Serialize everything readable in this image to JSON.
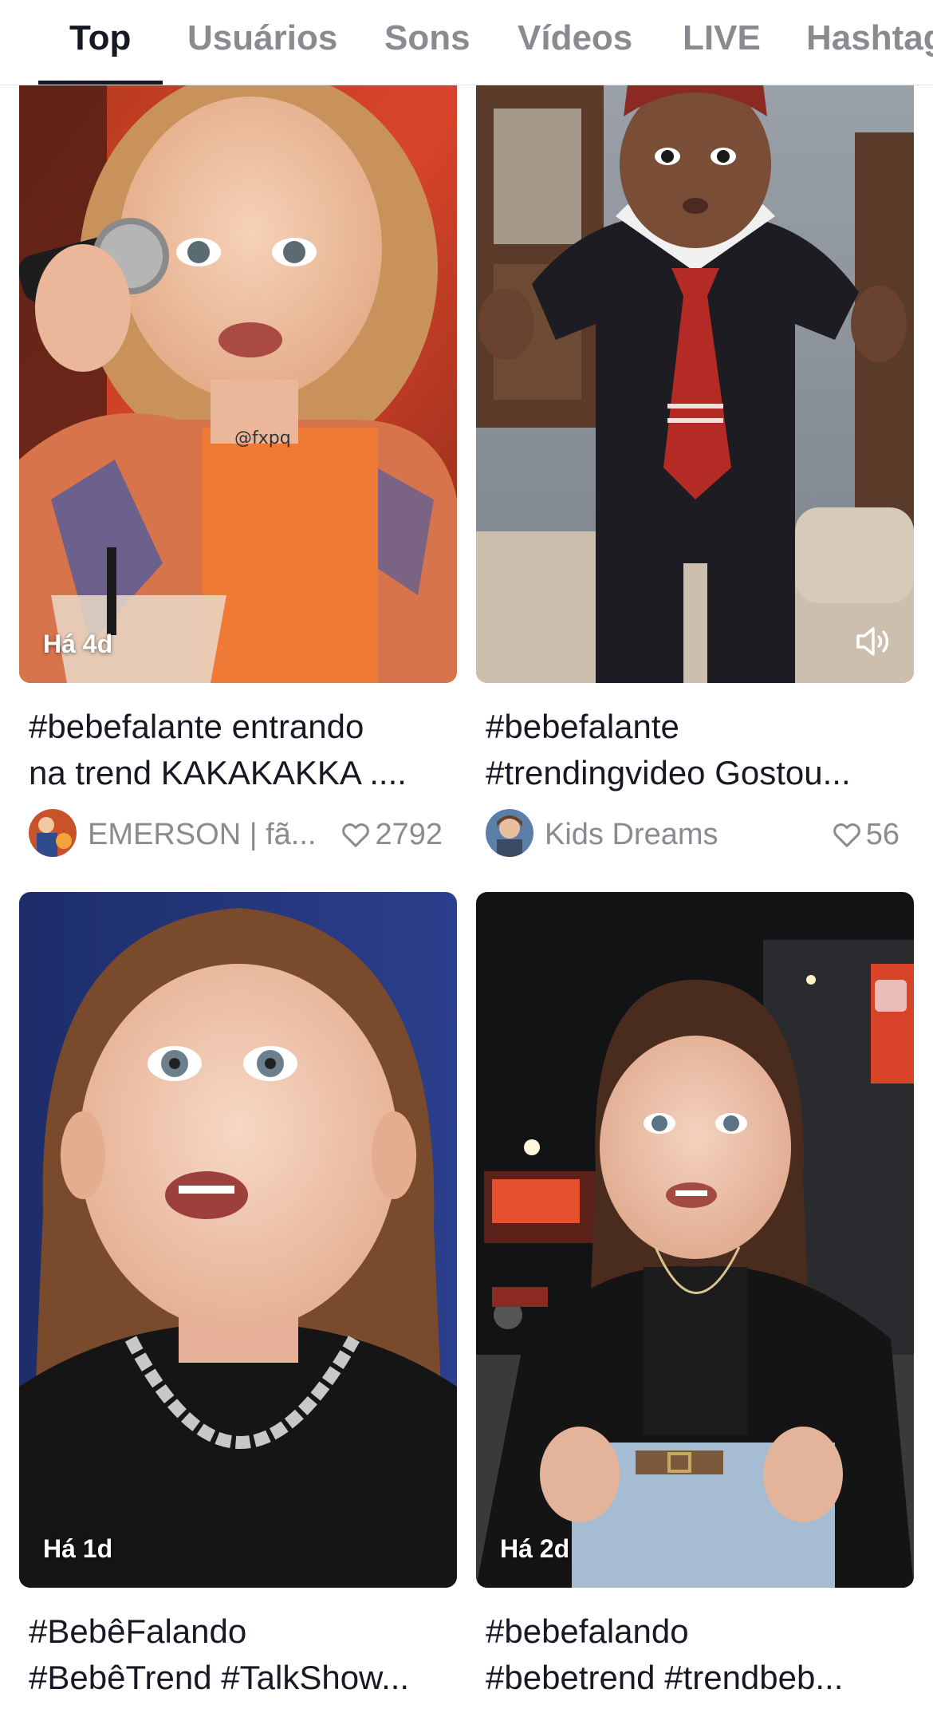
{
  "tabs": [
    {
      "label": "Top",
      "active": true
    },
    {
      "label": "Usuários",
      "active": false
    },
    {
      "label": "Sons",
      "active": false
    },
    {
      "label": "Vídeos",
      "active": false
    },
    {
      "label": "LIVE",
      "active": false
    },
    {
      "label": "Hashtags",
      "active": false
    }
  ],
  "cards": [
    {
      "age": "Há 4d",
      "caption_line1": "#bebefalante entrando",
      "caption_line2": "na trend KAKAKAKKA ....",
      "username": "EMERSON | fã...",
      "likes": "2792",
      "watermark": "@fxpq"
    },
    {
      "caption_line1": "#bebefalante",
      "caption_line2": "#trendingvideo Gostou...",
      "username": "Kids Dreams",
      "likes": "56",
      "sound_icon": "speaker-volume-icon"
    },
    {
      "age": "Há 1d",
      "caption_line1": "#BebêFalando",
      "caption_line2": "#BebêTrend #TalkShow..."
    },
    {
      "age": "Há 2d",
      "caption_line1": "#bebefalando",
      "caption_line2": "#bebetrend #trendbeb..."
    }
  ],
  "colors": {
    "text_primary": "#161823",
    "text_secondary": "#8a8b91",
    "divider": "#e3e3e4"
  }
}
